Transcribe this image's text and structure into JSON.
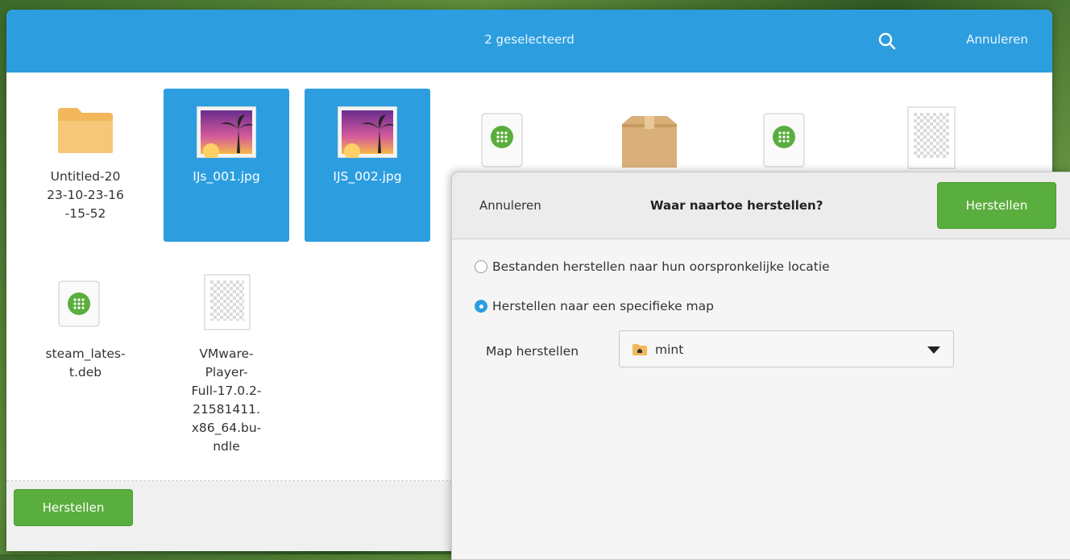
{
  "header": {
    "title": "2 geselecteerd",
    "cancel_label": "Annuleren",
    "search_icon": "search-icon"
  },
  "files": [
    {
      "name": "Untitled-2023-10-23-16-15-52",
      "lines": [
        "Untitled-20",
        "23-10-23-16",
        "-15-52"
      ],
      "icon": "folder-icon",
      "selected": false
    },
    {
      "name": "IJs_001.jpg",
      "lines": [
        "IJs_001.jpg"
      ],
      "icon": "image-icon",
      "selected": true
    },
    {
      "name": "IJS_002.jpg",
      "lines": [
        "IJS_002.jpg"
      ],
      "icon": "image-icon",
      "selected": true
    },
    {
      "name": "",
      "lines": [],
      "icon": "deb-package-icon",
      "selected": false
    },
    {
      "name": "",
      "lines": [],
      "icon": "archive-box-icon",
      "selected": false
    },
    {
      "name": "",
      "lines": [],
      "icon": "deb-package-icon",
      "selected": false
    },
    {
      "name": "",
      "lines": [],
      "icon": "blank-file-icon",
      "selected": false
    },
    {
      "name": "steam_latest.deb",
      "lines": [
        "steam_lates-",
        "t.deb"
      ],
      "icon": "deb-package-icon",
      "selected": false
    },
    {
      "name": "VMware-Player-Full-17.0.2-21581411.x86_64.bundle",
      "lines": [
        "VMware-",
        "Player-",
        "Full-17.0.2-",
        "21581411.",
        "x86_64.bu-",
        "ndle"
      ],
      "icon": "blank-file-icon",
      "selected": false
    }
  ],
  "footer": {
    "restore_label": "Herstellen"
  },
  "restore_dialog": {
    "cancel_label": "Annuleren",
    "title": "Waar naartoe herstellen?",
    "restore_label": "Herstellen",
    "options": [
      {
        "label": "Bestanden herstellen naar hun oorspronkelijke locatie",
        "checked": false
      },
      {
        "label": "Herstellen naar een specifieke map",
        "checked": true
      }
    ],
    "folder_label": "Map herstellen",
    "folder_value": "mint",
    "folder_icon": "home-folder-icon"
  },
  "colors": {
    "accent": "#2c9ee0",
    "green": "#5aae3d"
  }
}
